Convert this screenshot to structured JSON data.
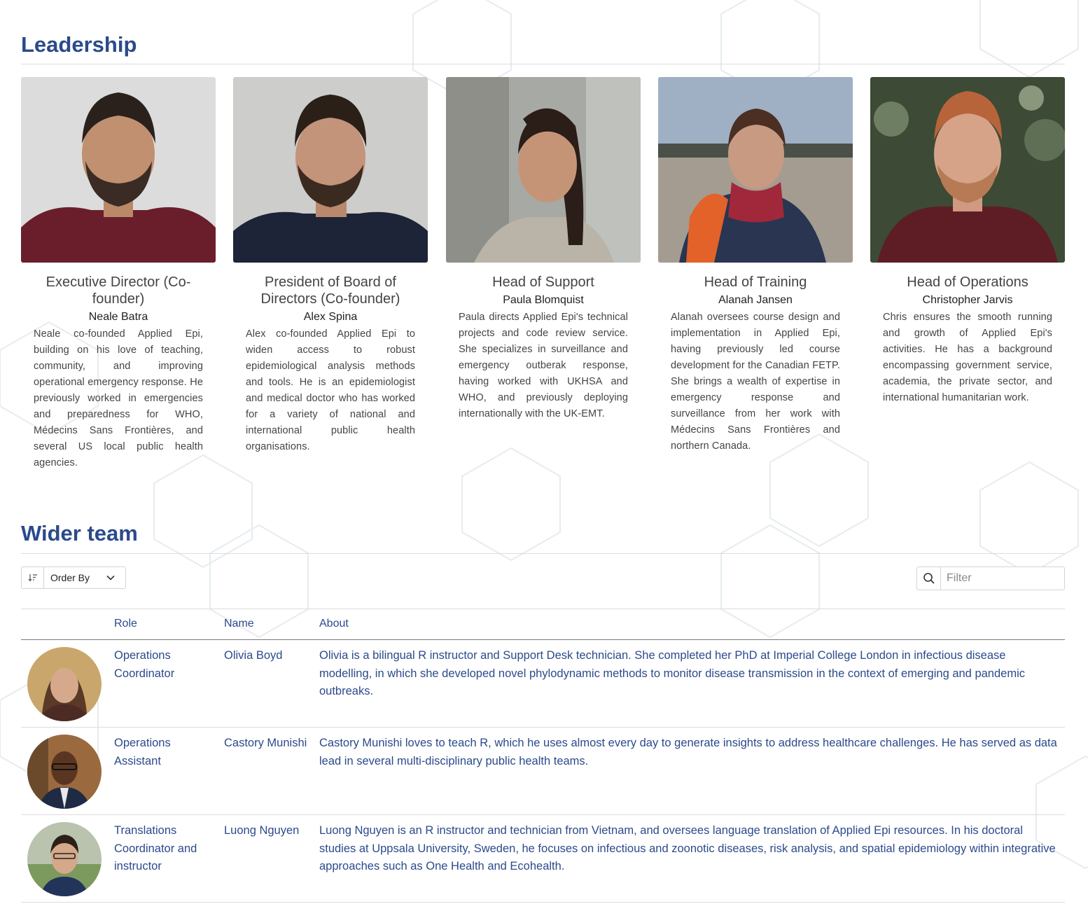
{
  "leadership": {
    "title": "Leadership",
    "members": [
      {
        "role": "Executive Director (Co-founder)",
        "name": "Neale Batra",
        "bio": "Neale co-founded Applied Epi, building on his love of teaching, community, and improving operational emergency response. He previously worked in emergencies and preparedness for WHO, Médecins Sans Frontières, and several US local public health agencies."
      },
      {
        "role": "President of Board of Directors (Co-founder)",
        "name": "Alex Spina",
        "bio": "Alex co-founded Applied Epi to widen access to robust epidemiological analysis methods and tools. He is an epidemiologist and medical doctor who has worked for a variety of national and international public health organisations."
      },
      {
        "role": "Head of Support",
        "name": "Paula Blomquist",
        "bio": "Paula directs Applied Epi's technical projects and code review service. She specializes in surveillance and emergency outberak response, having worked with UKHSA and WHO, and previously deploying internationally with the UK-EMT."
      },
      {
        "role": "Head of Training",
        "name": "Alanah Jansen",
        "bio": "Alanah oversees course design and implementation in Applied Epi, having previously led course development for the Canadian FETP. She brings a wealth of expertise in emergency response and surveillance from her work with Médecins Sans Frontières and northern Canada."
      },
      {
        "role": "Head of Operations",
        "name": "Christopher Jarvis",
        "bio": "Chris ensures the smooth running and growth of Applied Epi's activities. He has a background encompassing government service, academia, the private sector, and international humanitarian work."
      }
    ]
  },
  "wider_team": {
    "title": "Wider team",
    "order_by_label": "Order By",
    "filter_placeholder": "Filter",
    "columns": {
      "role": "Role",
      "name": "Name",
      "about": "About"
    },
    "rows": [
      {
        "role": "Operations Coordinator",
        "name": "Olivia Boyd",
        "about": "Olivia is a bilingual R instructor and Support Desk technician. She completed her PhD at Imperial College London in infectious disease modelling, in which she developed novel phylodynamic methods to monitor disease transmission in the context of emerging and pandemic outbreaks."
      },
      {
        "role": "Operations Assistant",
        "name": "Castory Munishi",
        "about": "Castory Munishi loves to teach R, which he uses almost every day to generate insights to address healthcare challenges. He has served as data lead in several multi-disciplinary public health teams."
      },
      {
        "role": "Translations Coordinator and instructor",
        "name": "Luong Nguyen",
        "about": "Luong Nguyen is an R instructor and technician from Vietnam, and oversees language translation of Applied Epi resources. In his doctoral studies at Uppsala University, Sweden, he focuses on infectious and zoonotic diseases, risk analysis, and spatial epidemiology within integrative approaches such as One Health and Ecohealth."
      }
    ]
  },
  "colors": {
    "heading": "#2b4a8b",
    "link_text": "#2b4a8b",
    "body_text": "#444444",
    "rule": "#dcdcdc"
  },
  "icons": {
    "sort": "sort-icon",
    "dropdown": "chevron-down-icon",
    "search": "search-icon"
  }
}
